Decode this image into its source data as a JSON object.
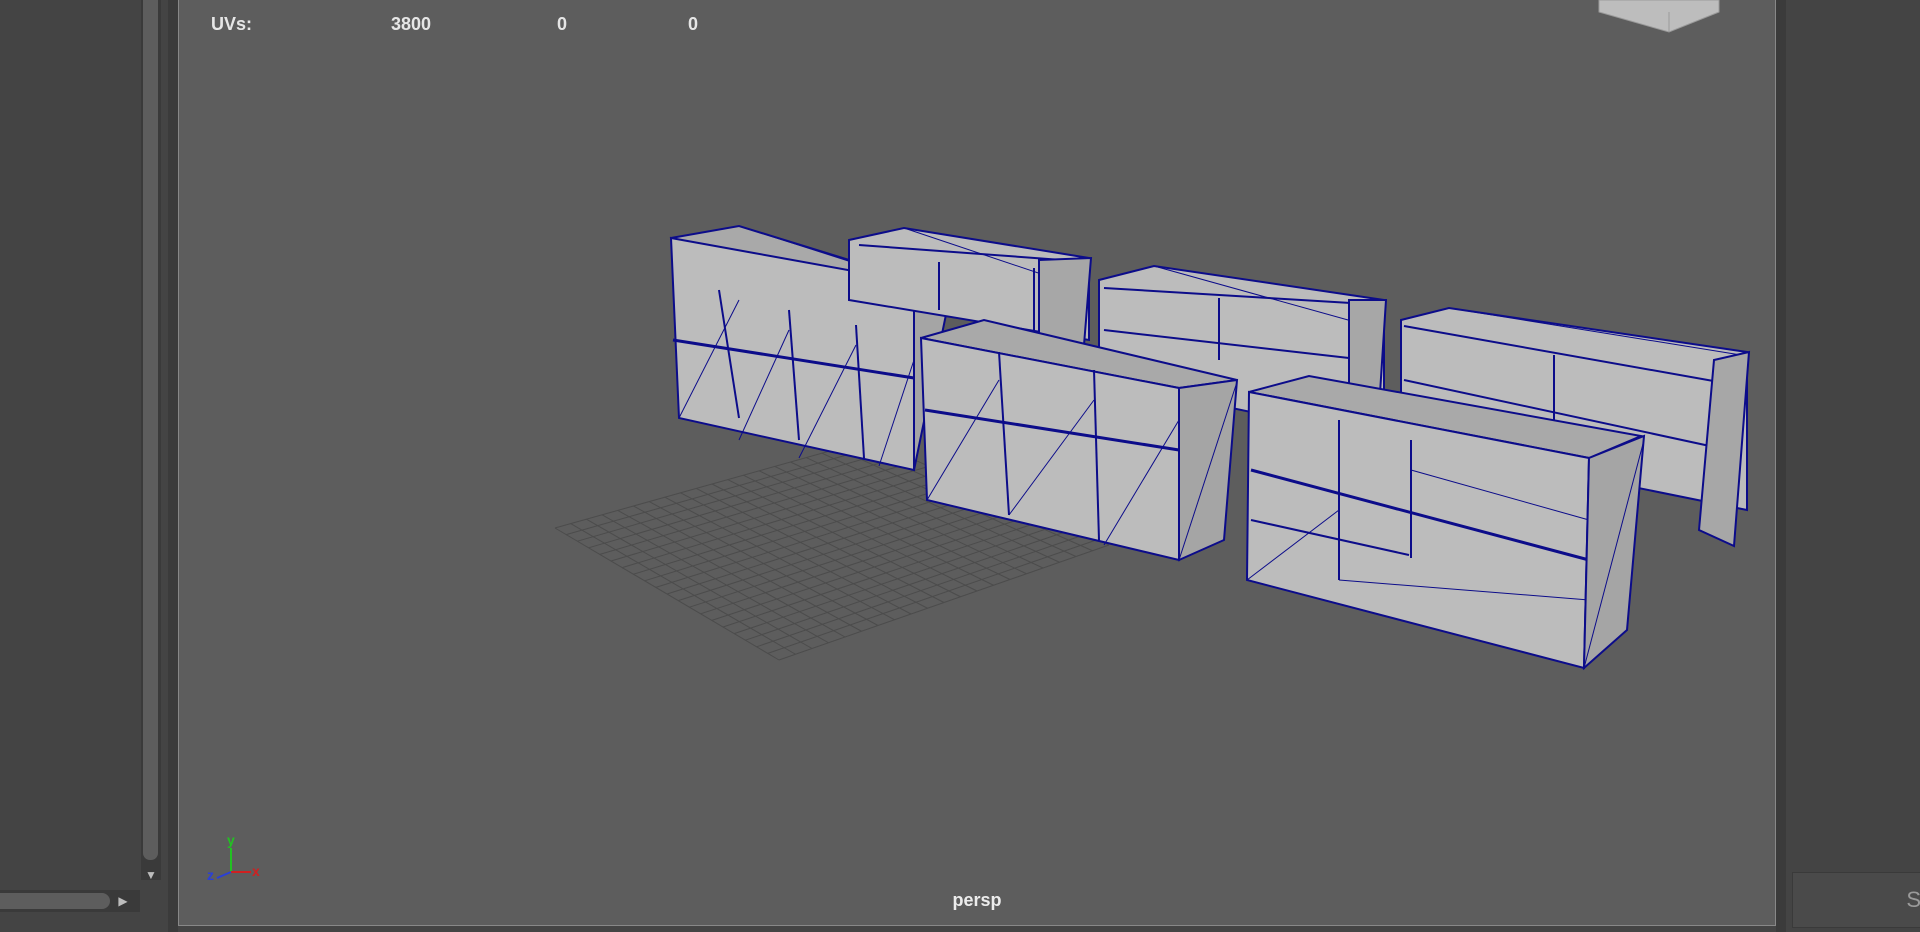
{
  "hud": {
    "uvs_label": "UVs:",
    "uvs_values": [
      "3800",
      "0",
      "0"
    ]
  },
  "viewport": {
    "camera_label": "persp"
  },
  "axis_gizmo": {
    "y_label": "y",
    "x_label": "x",
    "z_label": "z"
  },
  "right_panel": {
    "field_text": "S"
  },
  "colors": {
    "viewport_bg": "#5d5d5d",
    "wireframe": "#0c0c8a",
    "mesh_fill": "#b4b4b4"
  },
  "icons": [
    "scroll-down-arrow-icon",
    "scroll-right-arrow-icon",
    "view-cube-icon",
    "axis-gizmo-icon"
  ]
}
